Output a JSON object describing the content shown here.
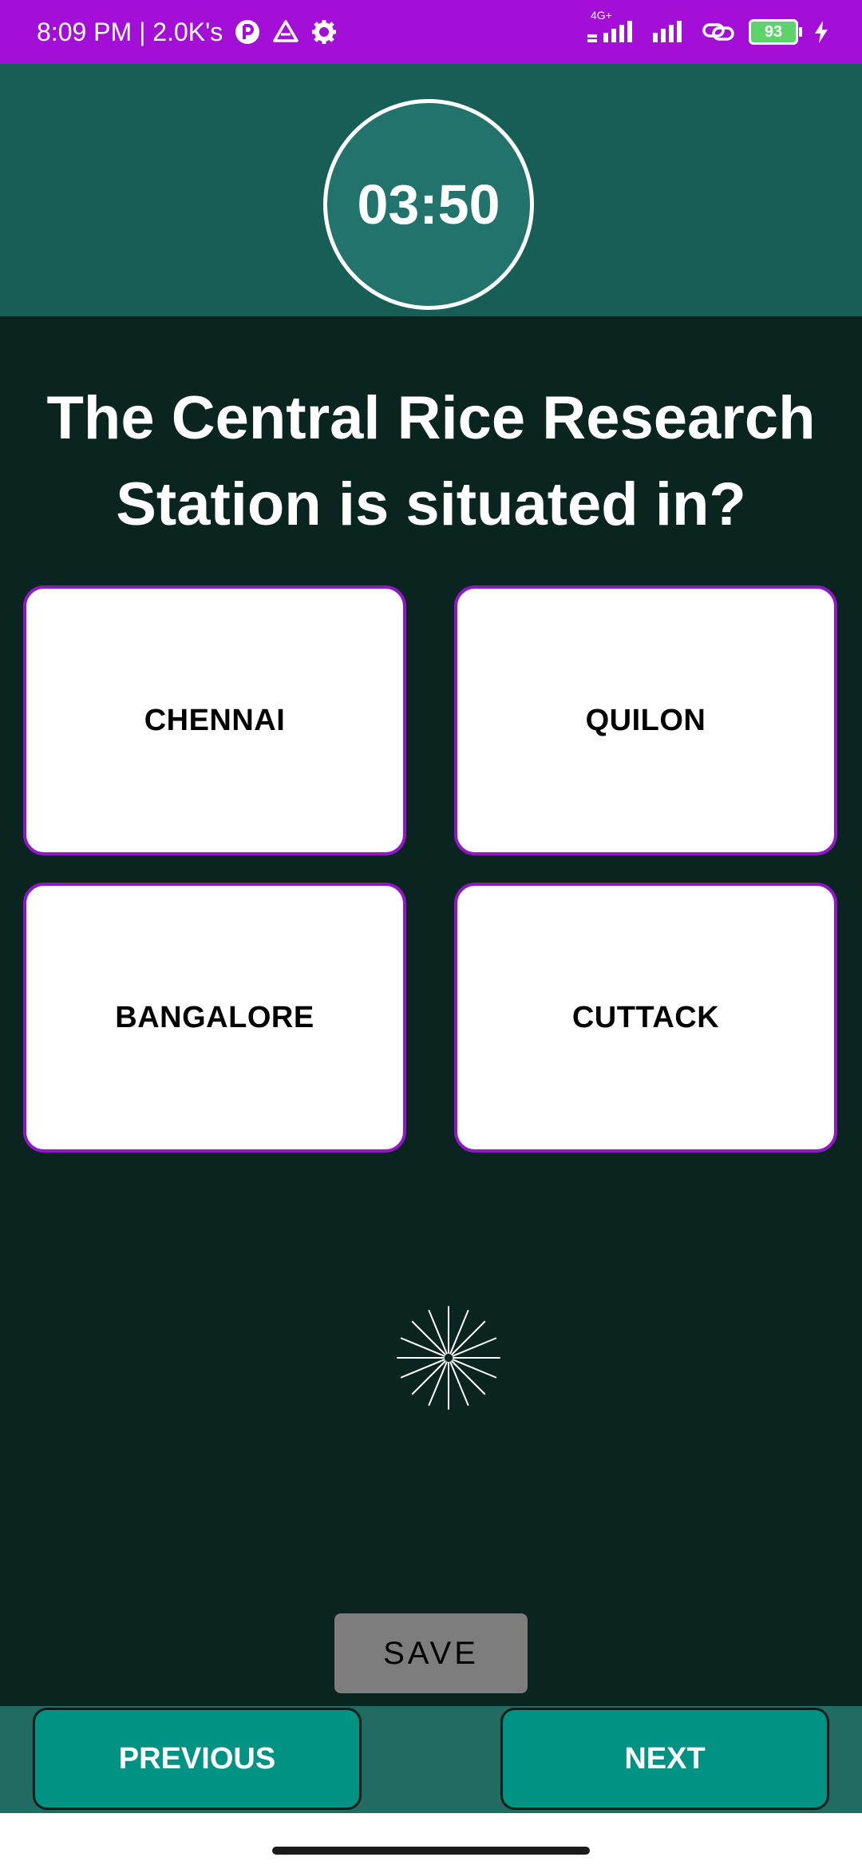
{
  "status_bar": {
    "time_speed": "8:09 PM | 2.0K's",
    "network": "4G+",
    "battery": "93",
    "icons": [
      "notification-p-icon",
      "drive-icon",
      "settings-gear-icon",
      "signal-4g-icon",
      "signal-icon",
      "link-icon",
      "battery-icon",
      "charging-icon"
    ]
  },
  "timer": {
    "value": "03:50"
  },
  "question": {
    "text": "The Central Rice Research Station is situated in?"
  },
  "options": [
    {
      "label": "CHENNAI"
    },
    {
      "label": "QUILON"
    },
    {
      "label": "BANGALORE"
    },
    {
      "label": "CUTTACK"
    }
  ],
  "actions": {
    "save_label": "SAVE",
    "previous_label": "PREVIOUS",
    "next_label": "NEXT"
  },
  "colors": {
    "status_bar": "#a30fd6",
    "header": "#175e57",
    "background": "#0a2420",
    "option_border": "#9016c8",
    "nav_button": "#009384"
  }
}
